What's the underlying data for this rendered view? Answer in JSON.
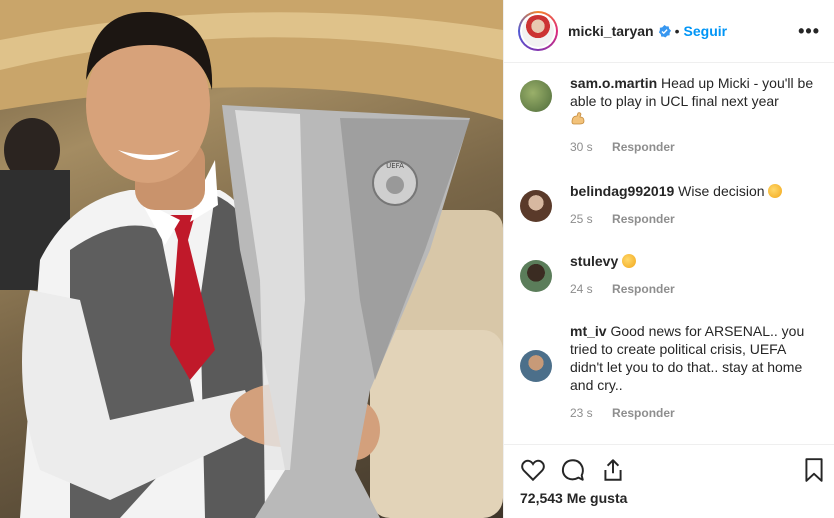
{
  "post": {
    "username": "micki_taryan",
    "separator": "•",
    "follow_label": "Seguir",
    "more_label": "•••"
  },
  "comments": [
    {
      "user": "sam.o.martin",
      "text": "Head up Micki - you'll be able to play in UCL final next year",
      "emoji": "flexed-biceps",
      "time": "30 s",
      "reply": "Responder"
    },
    {
      "user": "belindag992019",
      "text": "Wise decision",
      "emoji": "kiss-face",
      "time": "25 s",
      "reply": "Responder"
    },
    {
      "user": "stulevy",
      "text": "",
      "emoji": "sad-face",
      "time": "24 s",
      "reply": "Responder"
    },
    {
      "user": "mt_iv",
      "text": "Good news for ARSENAL.. you tried to create political crisis, UEFA didn't let you to do that.. stay at home and cry..",
      "emoji": "",
      "time": "23 s",
      "reply": "Responder"
    }
  ],
  "actions": {
    "likes": "72,543 Me gusta"
  },
  "photo": {
    "trophy_badge": "UEFA"
  }
}
